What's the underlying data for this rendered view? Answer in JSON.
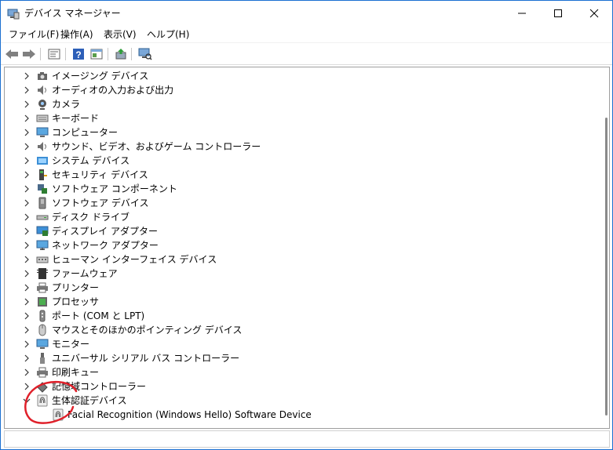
{
  "window": {
    "title": "デバイス マネージャー",
    "accent": "#1b6fd1",
    "icon": "device-manager-icon"
  },
  "caption": {
    "min_icon": "minimize-icon",
    "max_icon": "maximize-icon",
    "close_icon": "close-icon"
  },
  "menu": [
    {
      "label": "ファイル(F)"
    },
    {
      "label": "操作(A)"
    },
    {
      "label": "表示(V)"
    },
    {
      "label": "ヘルプ(H)"
    }
  ],
  "toolbar": [
    "back-arrow-icon",
    "forward-arrow-icon",
    "properties-icon",
    "help-icon",
    "view-icon",
    "update-driver-icon",
    "scan-hardware-icon"
  ],
  "tree": {
    "items": [
      {
        "label": "イメージング デバイス",
        "icon": "camera-icon",
        "expanded": false
      },
      {
        "label": "オーディオの入力および出力",
        "icon": "speaker-icon",
        "expanded": false
      },
      {
        "label": "カメラ",
        "icon": "webcam-icon",
        "expanded": false
      },
      {
        "label": "キーボード",
        "icon": "keyboard-icon",
        "expanded": false
      },
      {
        "label": "コンピューター",
        "icon": "monitor-icon",
        "expanded": false
      },
      {
        "label": "サウンド、ビデオ、およびゲーム コントローラー",
        "icon": "speaker-icon",
        "expanded": false
      },
      {
        "label": "システム デバイス",
        "icon": "system-folder-icon",
        "expanded": false
      },
      {
        "label": "セキュリティ デバイス",
        "icon": "security-key-icon",
        "expanded": false
      },
      {
        "label": "ソフトウェア コンポーネント",
        "icon": "software-component-icon",
        "expanded": false
      },
      {
        "label": "ソフトウェア デバイス",
        "icon": "software-device-icon",
        "expanded": false
      },
      {
        "label": "ディスク ドライブ",
        "icon": "disk-drive-icon",
        "expanded": false
      },
      {
        "label": "ディスプレイ アダプター",
        "icon": "display-adapter-icon",
        "expanded": false
      },
      {
        "label": "ネットワーク アダプター",
        "icon": "network-adapter-icon",
        "expanded": false
      },
      {
        "label": "ヒューマン インターフェイス デバイス",
        "icon": "hid-icon",
        "expanded": false
      },
      {
        "label": "ファームウェア",
        "icon": "firmware-icon",
        "expanded": false
      },
      {
        "label": "プリンター",
        "icon": "printer-icon",
        "expanded": false
      },
      {
        "label": "プロセッサ",
        "icon": "processor-icon",
        "expanded": false
      },
      {
        "label": "ポート (COM と LPT)",
        "icon": "port-icon",
        "expanded": false
      },
      {
        "label": "マウスとそのほかのポインティング デバイス",
        "icon": "mouse-icon",
        "expanded": false
      },
      {
        "label": "モニター",
        "icon": "monitor-icon",
        "expanded": false
      },
      {
        "label": "ユニバーサル シリアル バス コントローラー",
        "icon": "usb-icon",
        "expanded": false
      },
      {
        "label": "印刷キュー",
        "icon": "printer-icon",
        "expanded": false
      },
      {
        "label": "記憶域コントローラー",
        "icon": "storage-controller-icon",
        "expanded": false
      },
      {
        "label": "生体認証デバイス",
        "icon": "fingerprint-icon",
        "expanded": true
      }
    ],
    "child": {
      "label": "Facial Recognition (Windows Hello) Software Device",
      "icon": "fingerprint-icon"
    }
  },
  "annotation": {
    "color": "#e0202a",
    "shape": "red-circle-annotation"
  }
}
